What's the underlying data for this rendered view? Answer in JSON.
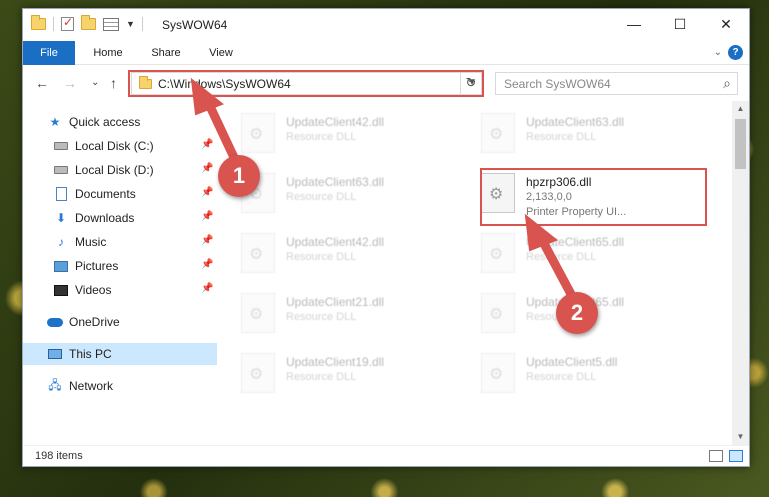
{
  "window": {
    "title": "SysWOW64",
    "controls": {
      "minimize": "—",
      "maximize": "☐",
      "close": "✕"
    }
  },
  "ribbon": {
    "tabs": [
      {
        "label": "File"
      },
      {
        "label": "Home"
      },
      {
        "label": "Share"
      },
      {
        "label": "View"
      }
    ],
    "help": "?"
  },
  "navigation": {
    "back": "←",
    "forward": "→",
    "recent": "⌄",
    "up": "↑",
    "address": "C:\\Windows\\SysWOW64",
    "refresh": "↻",
    "search_placeholder": "Search SysWOW64",
    "search_icon": "⌕"
  },
  "nav_pane": {
    "quick_access": "Quick access",
    "items": [
      {
        "label": "Local Disk (C:)",
        "icon": "drive-icon",
        "pinned": true
      },
      {
        "label": "Local Disk (D:)",
        "icon": "drive-icon",
        "pinned": true
      },
      {
        "label": "Documents",
        "icon": "documents-icon",
        "pinned": true
      },
      {
        "label": "Downloads",
        "icon": "downloads-icon",
        "pinned": true
      },
      {
        "label": "Music",
        "icon": "music-icon",
        "pinned": true
      },
      {
        "label": "Pictures",
        "icon": "pictures-icon",
        "pinned": true
      },
      {
        "label": "Videos",
        "icon": "videos-icon",
        "pinned": true
      }
    ],
    "onedrive": "OneDrive",
    "this_pc": "This PC",
    "network": "Network"
  },
  "files": [
    {
      "name": "UpdateClient42.dll",
      "meta": "Resource DLL",
      "faded": true
    },
    {
      "name": "UpdateClient63.dll",
      "meta": "Resource DLL",
      "faded": true
    },
    {
      "name": "UpdateClient63.dll",
      "meta": "Resource DLL",
      "faded": true
    },
    {
      "name": "hpzrp306.dll",
      "meta": "2,133,0,0",
      "meta2": "Printer Property UI...",
      "faded": false,
      "highlighted": true
    },
    {
      "name": "UpdateClient42.dll",
      "meta": "Resource DLL",
      "faded": true
    },
    {
      "name": "UpdateClient65.dll",
      "meta": "Resource DLL",
      "faded": true
    },
    {
      "name": "UpdateClient21.dll",
      "meta": "Resource DLL",
      "faded": true
    },
    {
      "name": "UpdateClient65.dll",
      "meta": "Resource DLL",
      "faded": true
    },
    {
      "name": "UpdateClient19.dll",
      "meta": "Resource DLL",
      "faded": true
    },
    {
      "name": "UpdateClient5.dll",
      "meta": "Resource DLL",
      "faded": true
    }
  ],
  "status": {
    "item_count": "198 items"
  },
  "annotations": {
    "marker1": "1",
    "marker2": "2",
    "color": "#d9534f"
  }
}
